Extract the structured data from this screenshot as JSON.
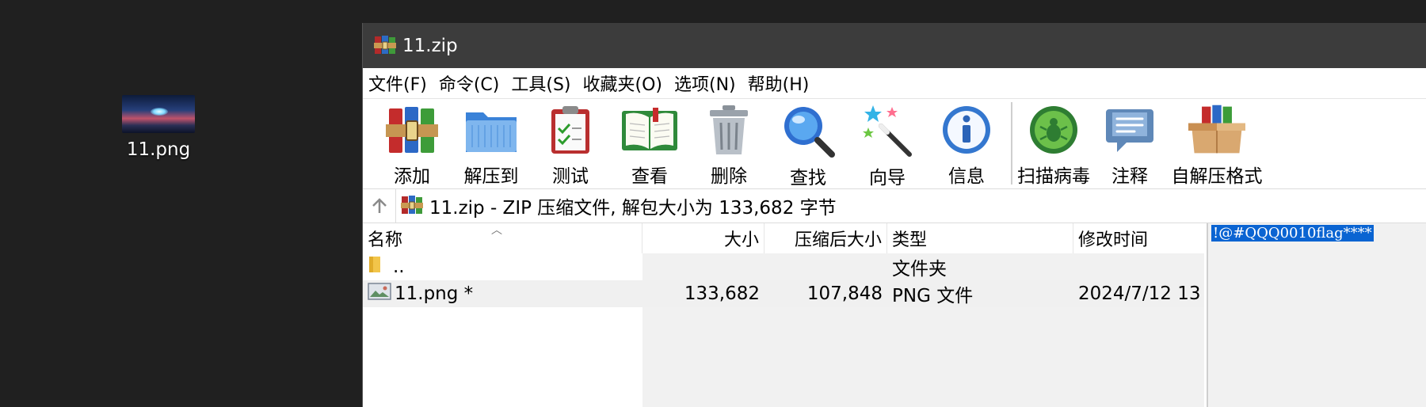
{
  "desktop": {
    "icon_label": "11.png"
  },
  "window": {
    "title": "11.zip"
  },
  "menu": [
    "文件(F)",
    "命令(C)",
    "工具(S)",
    "收藏夹(O)",
    "选项(N)",
    "帮助(H)"
  ],
  "toolbar": {
    "add": "添加",
    "extract": "解压到",
    "test": "测试",
    "view": "查看",
    "delete": "删除",
    "find": "查找",
    "wizard": "向导",
    "info": "信息",
    "scan": "扫描病毒",
    "comment": "注释",
    "sfx": "自解压格式"
  },
  "address": {
    "text": "11.zip - ZIP 压缩文件, 解包大小为 133,682 字节"
  },
  "columns": {
    "name": "名称",
    "size": "大小",
    "packed": "压缩后大小",
    "type": "类型",
    "modified": "修改时间"
  },
  "files": [
    {
      "name": "..",
      "size": "",
      "packed": "",
      "type": "文件夹",
      "modified": ""
    },
    {
      "name": "11.png *",
      "size": "133,682",
      "packed": "107,848",
      "type": "PNG 文件",
      "modified": "2024/7/12 13"
    }
  ],
  "comment_text": "!@#QQQ0010flag****"
}
